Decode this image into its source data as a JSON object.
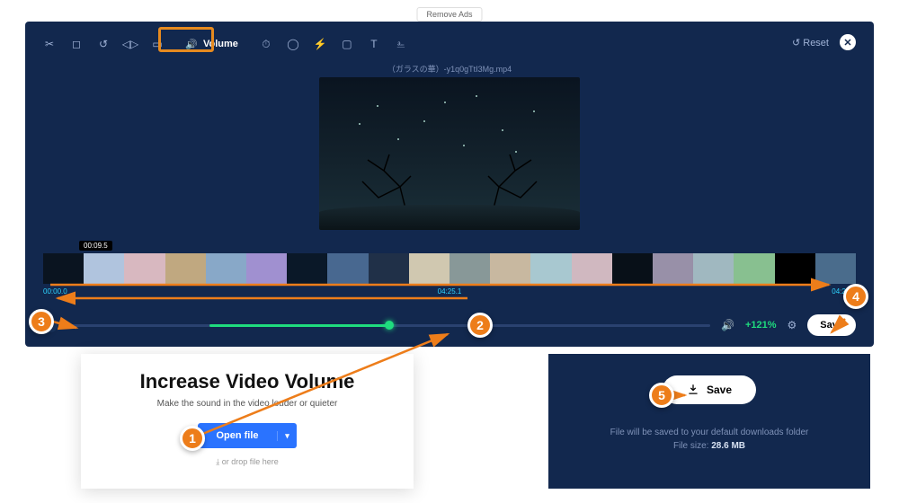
{
  "remove_ads_label": "Remove Ads",
  "toolbar": {
    "volume_chip_label": "Volume",
    "reset_label": "Reset"
  },
  "filename": "（ガラスの華）-y1q0gTtI3Mg.mp4",
  "timeline": {
    "tooltip": "00:09.5",
    "start": "00:00.0",
    "mid": "04:25.1",
    "end": "04:25.1"
  },
  "controls": {
    "volume_readout": "+121%",
    "save_label": "Save"
  },
  "left_panel": {
    "title": "Increase Video Volume",
    "subtitle": "Make the sound in the video louder or quieter",
    "open_label": "Open file",
    "drop_label": "or drop file here"
  },
  "right_panel": {
    "save_label": "Save",
    "info_line": "File will be saved to your default downloads folder",
    "size_label": "File size:",
    "size_value": "28.6 MB"
  },
  "badges": {
    "b1": "1",
    "b2": "2",
    "b3": "3",
    "b4": "4",
    "b5": "5"
  }
}
